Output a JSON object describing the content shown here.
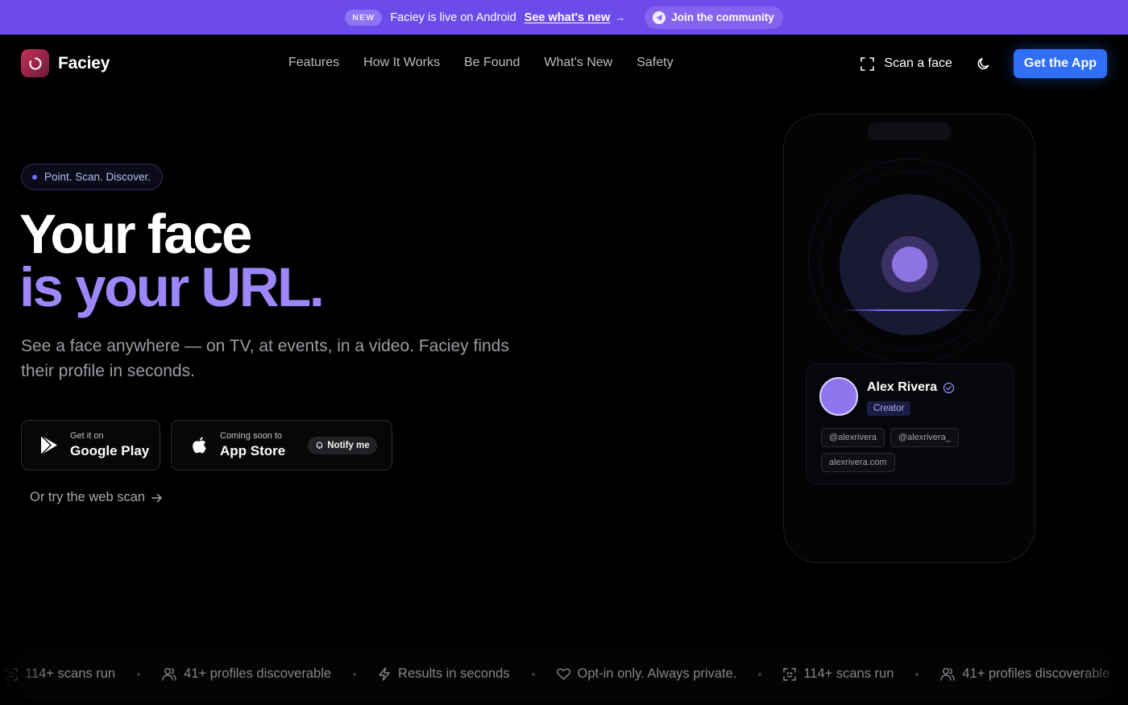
{
  "announcement": {
    "badge": "NEW",
    "text": "Faciey is live on Android",
    "link": "See what's new",
    "arrow": "→",
    "community": "Join the community"
  },
  "nav": {
    "brand": "Faciey",
    "links": [
      "Features",
      "How It Works",
      "Be Found",
      "What's New",
      "Safety"
    ],
    "scan_label": "Scan a face",
    "cta": "Get the App"
  },
  "hero": {
    "eyebrow": "Point. Scan. Discover.",
    "headline_line1": "Your face",
    "headline_line2": "is your URL.",
    "subtitle": "See a face anywhere — on TV, at events, in a video. Faciey finds their profile in seconds.",
    "google_play": {
      "small": "Get it on",
      "big": "Google Play"
    },
    "app_store": {
      "small": "Coming soon to",
      "big": "App Store",
      "notify": "Notify me"
    },
    "web_scan": "Or try the web scan"
  },
  "phone": {
    "profile_name": "Alex Rivera",
    "role": "Creator",
    "tags": [
      "@alexrivera",
      "@alexrivera_",
      "alexrivera.com"
    ]
  },
  "ticker": {
    "items": [
      {
        "icon": "scan-icon",
        "text": "114+ scans run"
      },
      {
        "icon": "users-icon",
        "text": "41+ profiles discoverable"
      },
      {
        "icon": "bolt-icon",
        "text": "Results in seconds"
      },
      {
        "icon": "heart-icon",
        "text": "Opt-in only. Always private."
      },
      {
        "icon": "scan-icon",
        "text": "114+ scans run"
      },
      {
        "icon": "users-icon",
        "text": "41+ profiles discoverable"
      }
    ]
  },
  "colors": {
    "announce_bg": "#6d4bea",
    "accent_purple": "#9d86f7",
    "cta_blue": "#2f6ef5",
    "logo_red": "#c4325a"
  }
}
